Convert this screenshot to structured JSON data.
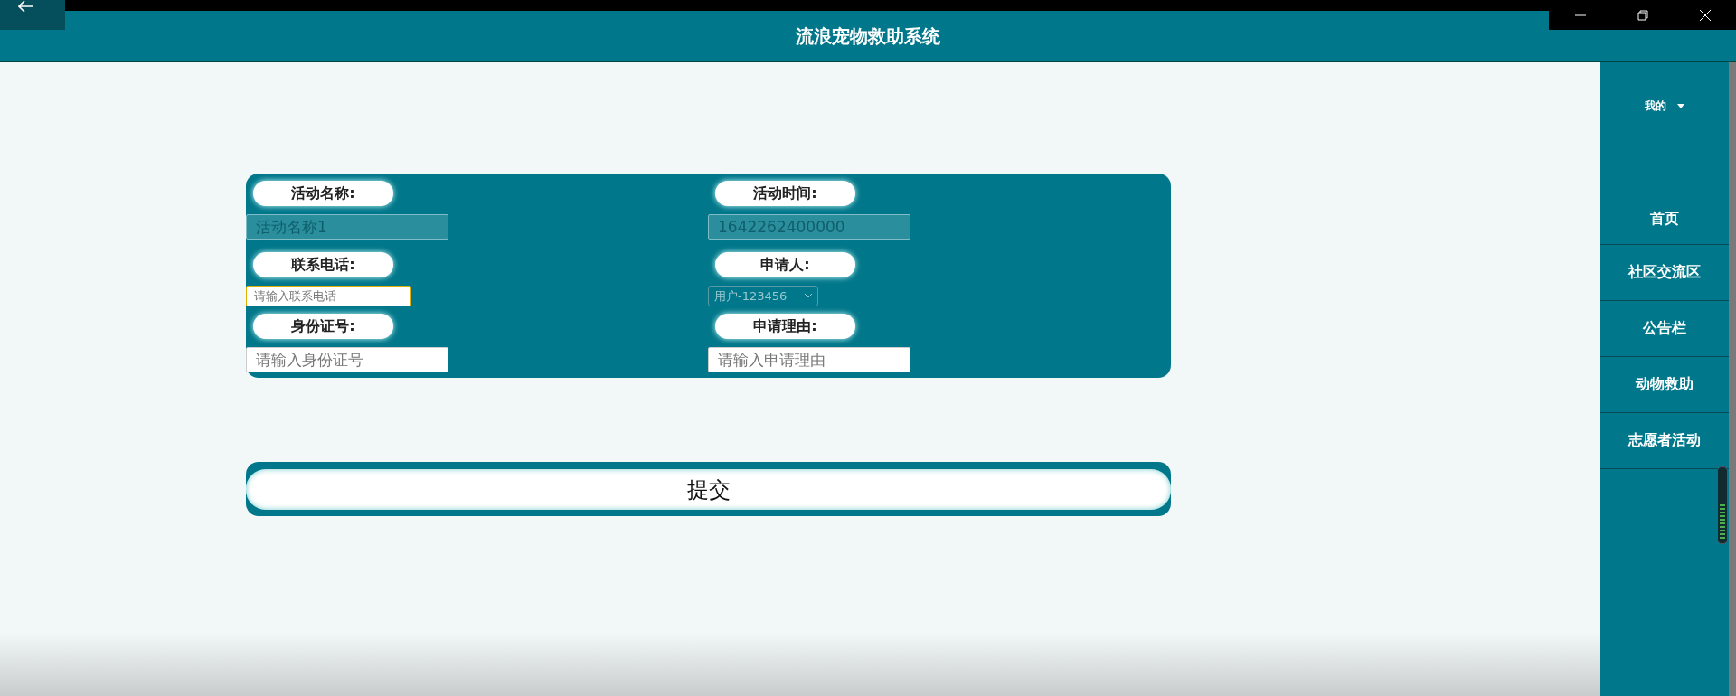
{
  "header": {
    "title": "流浪宠物救助系统"
  },
  "form": {
    "fields": [
      {
        "label": "活动名称:",
        "kind": "text",
        "value": "活动名称1",
        "disabled": true,
        "focused": false
      },
      {
        "label": "活动时间:",
        "kind": "text",
        "value": "1642262400000",
        "disabled": true,
        "focused": false
      },
      {
        "label": "联系电话:",
        "kind": "text",
        "placeholder": "请输入联系电话",
        "disabled": false,
        "focused": true
      },
      {
        "label": "申请人:",
        "kind": "select",
        "value": "用户-123456",
        "disabled": true,
        "focused": false
      },
      {
        "label": "身份证号:",
        "kind": "text",
        "placeholder": "请输入身份证号",
        "disabled": false,
        "focused": false
      },
      {
        "label": "申请理由:",
        "kind": "text",
        "placeholder": "请输入申请理由",
        "disabled": false,
        "focused": false
      }
    ],
    "submit": "提交"
  },
  "sidebar": {
    "user_menu": "我的",
    "items": [
      {
        "label": "首页"
      },
      {
        "label": "社区交流区"
      },
      {
        "label": "公告栏"
      },
      {
        "label": "动物救助"
      },
      {
        "label": "志愿者活动"
      }
    ]
  }
}
